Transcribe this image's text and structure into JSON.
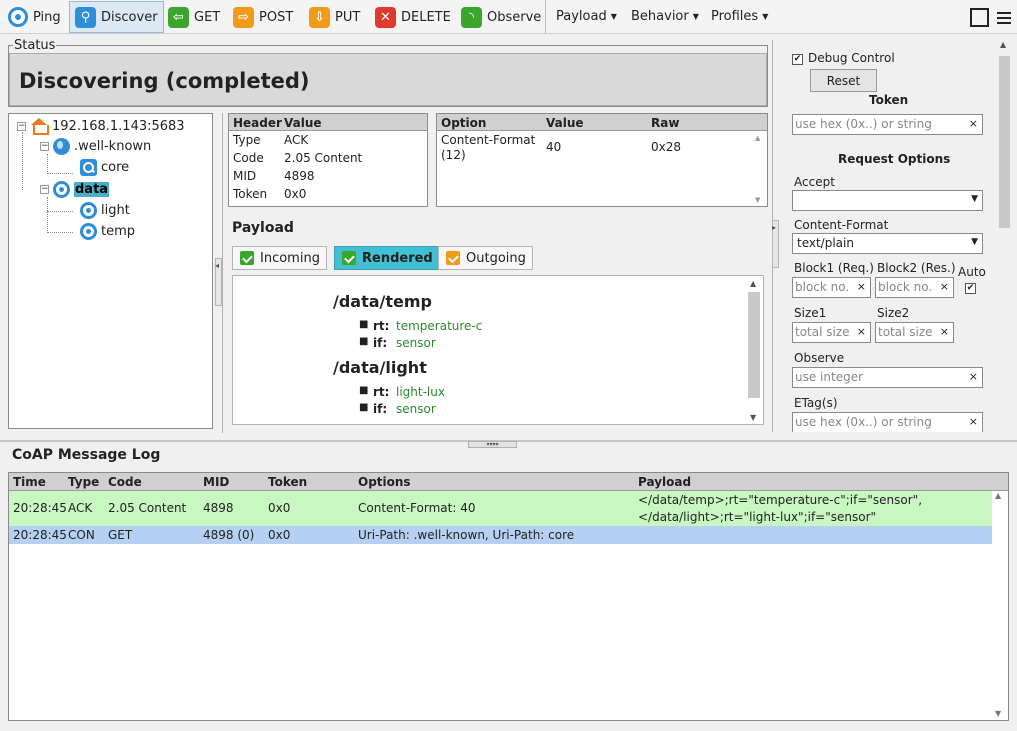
{
  "toolbar": {
    "ping": "Ping",
    "discover": "Discover",
    "get": "GET",
    "post": "POST",
    "put": "PUT",
    "delete": "DELETE",
    "observe": "Observe",
    "menus": [
      "Payload",
      "Behavior",
      "Profiles"
    ]
  },
  "status": {
    "legend": "Status",
    "text": "Discovering (completed)"
  },
  "tree": {
    "root": "192.168.1.143:5683",
    "well_known": ".well-known",
    "core": "core",
    "data": "data",
    "light": "light",
    "temp": "temp"
  },
  "header_table": {
    "columns": [
      "Header",
      "Value"
    ],
    "rows": [
      [
        "Type",
        "ACK"
      ],
      [
        "Code",
        "2.05 Content"
      ],
      [
        "MID",
        "4898"
      ],
      [
        "Token",
        "0x0"
      ]
    ]
  },
  "option_table": {
    "columns": [
      "Option",
      "Value",
      "Raw"
    ],
    "rows": [
      [
        "Content-Format",
        "(12)",
        "40",
        "0x28"
      ]
    ]
  },
  "payload": {
    "title": "Payload",
    "tabs": [
      "Incoming",
      "Rendered",
      "Outgoing"
    ],
    "active_tab": "Rendered",
    "resources": [
      {
        "path": "/data/temp",
        "attrs": [
          {
            "k": "rt:",
            "v": "temperature-c"
          },
          {
            "k": "if:",
            "v": "sensor"
          }
        ]
      },
      {
        "path": "/data/light",
        "attrs": [
          {
            "k": "rt:",
            "v": "light-lux"
          },
          {
            "k": "if:",
            "v": "sensor"
          }
        ]
      }
    ]
  },
  "request_panel": {
    "debug_control": "Debug Control",
    "reset": "Reset",
    "token_title": "Token",
    "token_placeholder": "use hex (0x..) or string",
    "request_options_title": "Request Options",
    "accept_label": "Accept",
    "accept_value": "",
    "content_format_label": "Content-Format",
    "content_format_value": "text/plain",
    "block1_label": "Block1 (Req.)",
    "block2_label": "Block2 (Res.)",
    "auto_label": "Auto",
    "block_placeholder": "block no.",
    "size1_label": "Size1",
    "size2_label": "Size2",
    "size_placeholder": "total size",
    "observe_label": "Observe",
    "observe_placeholder": "use integer",
    "etag_label": "ETag(s)",
    "etag_placeholder": "use hex (0x..) or string",
    "clear_glyph": "×"
  },
  "log": {
    "title": "CoAP Message Log",
    "columns": [
      "Time",
      "Type",
      "Code",
      "MID",
      "Token",
      "Options",
      "Payload"
    ],
    "rows": [
      {
        "time": "20:28:45",
        "type": "ACK",
        "code": "2.05 Content",
        "mid": "4898",
        "token": "0x0",
        "options": "Content-Format: 40",
        "payload_line1": "</data/temp>;rt=\"temperature-c\";if=\"sensor\",",
        "payload_line2": "</data/light>;rt=\"light-lux\";if=\"sensor\""
      },
      {
        "time": "20:28:45",
        "type": "CON",
        "code": "GET",
        "mid": "4898 (0)",
        "token": "0x0",
        "options": "Uri-Path: .well-known, Uri-Path: core",
        "payload_line1": "",
        "payload_line2": ""
      }
    ]
  },
  "colors": {
    "incoming_row": "#c8f7c1",
    "outgoing_row": "#b6d0f3",
    "rendered_tab": "#42bfd3",
    "status_bg": "#d9d9d9"
  }
}
